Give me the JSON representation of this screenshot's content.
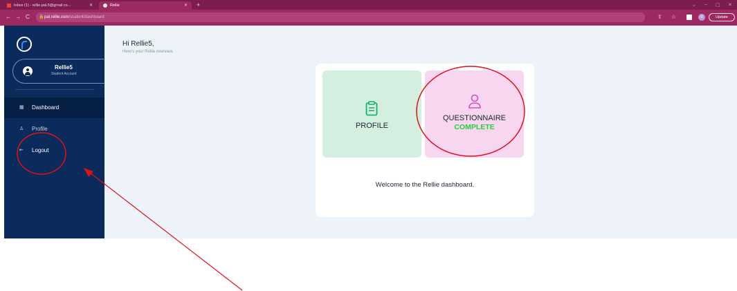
{
  "browser": {
    "tabs": [
      {
        "title": "Inbox (1) - rellie.pal.5@gmail.co..."
      },
      {
        "title": "Rellie"
      }
    ],
    "url": {
      "host": "pal.rellie.com",
      "path": "/student/dashboard"
    },
    "update_label": "Update",
    "profile_initial": "R"
  },
  "sidebar": {
    "account": {
      "name": "Rellie5",
      "type": "Student Account"
    },
    "items": [
      {
        "label": "Dashboard"
      },
      {
        "label": "Profile"
      },
      {
        "label": "Logout"
      }
    ]
  },
  "main": {
    "greeting": "Hi Rellie5,",
    "subtitle": "Here's your Rellie overview.",
    "tiles": {
      "profile": {
        "title": "PROFILE"
      },
      "questionnaire": {
        "title": "QUESTIONNAIRE",
        "status": "COMPLETE"
      }
    },
    "welcome": "Welcome to the Rellie dashboard."
  },
  "annotations": {
    "color": "#e0101a"
  },
  "icons": {
    "back": "arrow-left-icon",
    "forward": "arrow-right-icon",
    "reload": "reload-icon",
    "lock": "lock-icon",
    "share": "share-icon",
    "star": "star-icon",
    "dashboard": "grid-icon",
    "profile": "person-icon",
    "logout": "logout-icon",
    "clipboard": "clipboard-icon",
    "user": "user-outline-icon"
  }
}
